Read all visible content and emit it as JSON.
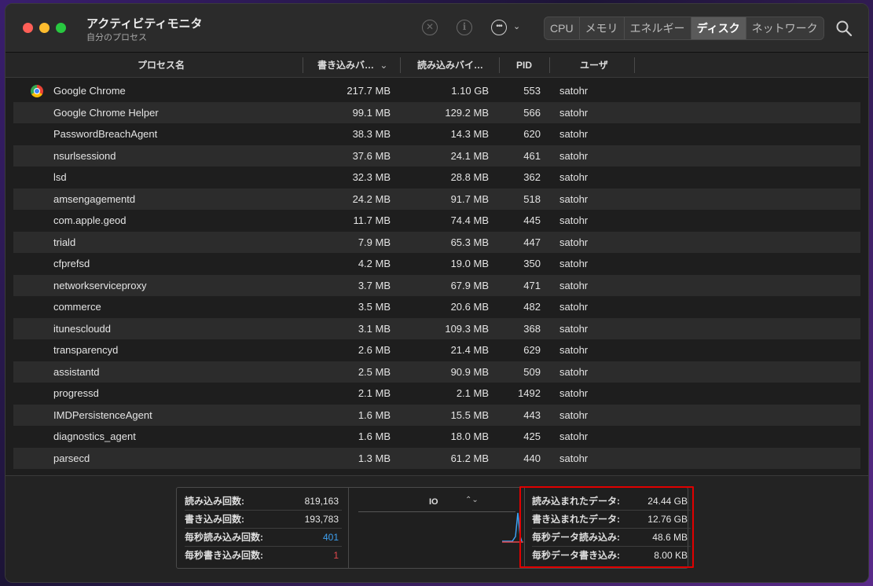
{
  "window": {
    "title": "アクティビティモニタ",
    "subtitle": "自分のプロセス"
  },
  "toolbar": {
    "stop_icon": "x-circle-icon",
    "info_icon": "info-icon",
    "more_icon": "ellipsis-circle-icon",
    "search_icon": "magnifier-icon",
    "tabs": [
      {
        "label": "CPU"
      },
      {
        "label": "メモリ"
      },
      {
        "label": "エネルギー"
      },
      {
        "label": "ディスク"
      },
      {
        "label": "ネットワーク"
      }
    ],
    "active_tab": "ディスク"
  },
  "table": {
    "headers": {
      "name": "プロセス名",
      "write": "書き込みバ…",
      "read": "読み込みバイ…",
      "pid": "PID",
      "user": "ユーザ"
    },
    "rows": [
      {
        "name": "Google Chrome",
        "write": "217.7 MB",
        "read": "1.10 GB",
        "pid": "553",
        "user": "satohr"
      },
      {
        "name": "Google Chrome Helper",
        "write": "99.1 MB",
        "read": "129.2 MB",
        "pid": "566",
        "user": "satohr"
      },
      {
        "name": "PasswordBreachAgent",
        "write": "38.3 MB",
        "read": "14.3 MB",
        "pid": "620",
        "user": "satohr"
      },
      {
        "name": "nsurlsessiond",
        "write": "37.6 MB",
        "read": "24.1 MB",
        "pid": "461",
        "user": "satohr"
      },
      {
        "name": "lsd",
        "write": "32.3 MB",
        "read": "28.8 MB",
        "pid": "362",
        "user": "satohr"
      },
      {
        "name": "amsengagementd",
        "write": "24.2 MB",
        "read": "91.7 MB",
        "pid": "518",
        "user": "satohr"
      },
      {
        "name": "com.apple.geod",
        "write": "11.7 MB",
        "read": "74.4 MB",
        "pid": "445",
        "user": "satohr"
      },
      {
        "name": "triald",
        "write": "7.9 MB",
        "read": "65.3 MB",
        "pid": "447",
        "user": "satohr"
      },
      {
        "name": "cfprefsd",
        "write": "4.2 MB",
        "read": "19.0 MB",
        "pid": "350",
        "user": "satohr"
      },
      {
        "name": "networkserviceproxy",
        "write": "3.7 MB",
        "read": "67.9 MB",
        "pid": "471",
        "user": "satohr"
      },
      {
        "name": "commerce",
        "write": "3.5 MB",
        "read": "20.6 MB",
        "pid": "482",
        "user": "satohr"
      },
      {
        "name": "itunescloudd",
        "write": "3.1 MB",
        "read": "109.3 MB",
        "pid": "368",
        "user": "satohr"
      },
      {
        "name": "transparencyd",
        "write": "2.6 MB",
        "read": "21.4 MB",
        "pid": "629",
        "user": "satohr"
      },
      {
        "name": "assistantd",
        "write": "2.5 MB",
        "read": "90.9 MB",
        "pid": "509",
        "user": "satohr"
      },
      {
        "name": "progressd",
        "write": "2.1 MB",
        "read": "2.1 MB",
        "pid": "1492",
        "user": "satohr"
      },
      {
        "name": "IMDPersistenceAgent",
        "write": "1.6 MB",
        "read": "15.5 MB",
        "pid": "443",
        "user": "satohr"
      },
      {
        "name": "diagnostics_agent",
        "write": "1.6 MB",
        "read": "18.0 MB",
        "pid": "425",
        "user": "satohr"
      },
      {
        "name": "parsecd",
        "write": "1.3 MB",
        "read": "61.2 MB",
        "pid": "440",
        "user": "satohr"
      }
    ]
  },
  "stats_left": [
    {
      "label": "読み込み回数:",
      "value": "819,163",
      "color": ""
    },
    {
      "label": "書き込み回数:",
      "value": "193,783",
      "color": ""
    },
    {
      "label": "毎秒読み込み回数:",
      "value": "401",
      "color": "#3ea0f0"
    },
    {
      "label": "毎秒書き込み回数:",
      "value": "1",
      "color": "#e5484d"
    }
  ],
  "graph": {
    "selector": "IO"
  },
  "stats_right": [
    {
      "label": "読み込まれたデータ:",
      "value": "24.44 GB"
    },
    {
      "label": "書き込まれたデータ:",
      "value": "12.76 GB"
    },
    {
      "label": "毎秒データ読み込み:",
      "value": "48.6 MB"
    },
    {
      "label": "毎秒データ書き込み:",
      "value": "8.00 KB"
    }
  ],
  "colors": {
    "highlight": "#e00000",
    "read_series": "#3ea0f0",
    "write_series": "#e5484d"
  }
}
